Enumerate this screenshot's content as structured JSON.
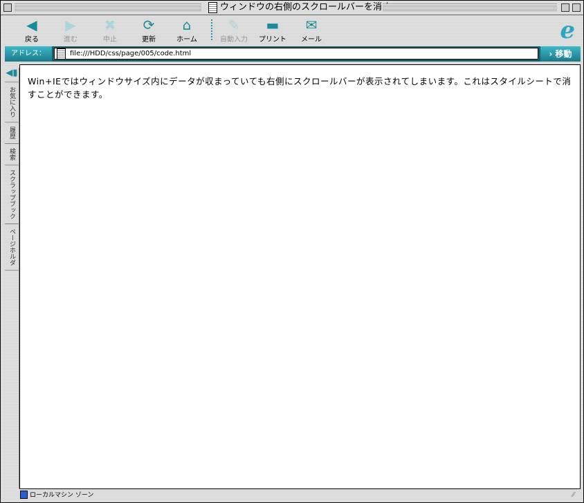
{
  "window": {
    "title": "ウィンドウの右側のスクロールバーを消す"
  },
  "toolbar": {
    "buttons": [
      {
        "label": "戻る",
        "icon": "back-arrow-icon",
        "enabled": true
      },
      {
        "label": "進む",
        "icon": "forward-arrow-icon",
        "enabled": false
      },
      {
        "label": "中止",
        "icon": "stop-icon",
        "enabled": false
      },
      {
        "label": "更新",
        "icon": "refresh-icon",
        "enabled": true
      },
      {
        "label": "ホーム",
        "icon": "home-icon",
        "enabled": true
      },
      {
        "label": "自動入力",
        "icon": "autofill-icon",
        "enabled": false
      },
      {
        "label": "プリント",
        "icon": "print-icon",
        "enabled": true
      },
      {
        "label": "メール",
        "icon": "mail-icon",
        "enabled": true
      }
    ]
  },
  "address": {
    "label": "アドレス：",
    "value": "file:///HDD/css/page/005/code.html",
    "go": "移動"
  },
  "sidebar": {
    "tabs": [
      "お気に入り",
      "履歴",
      "検索",
      "スクラップブック",
      "ページホルダ"
    ]
  },
  "content": {
    "text": "Win+IEではウィンドウサイズ内にデータが収まっていても右側にスクロールバーが表示されてしまいます。これはスタイルシートで消すことができます。"
  },
  "status": {
    "zone": "ローカルマシン ゾーン"
  },
  "colors": {
    "accent": "#1a8a9a",
    "address_bar": "#17606a"
  }
}
